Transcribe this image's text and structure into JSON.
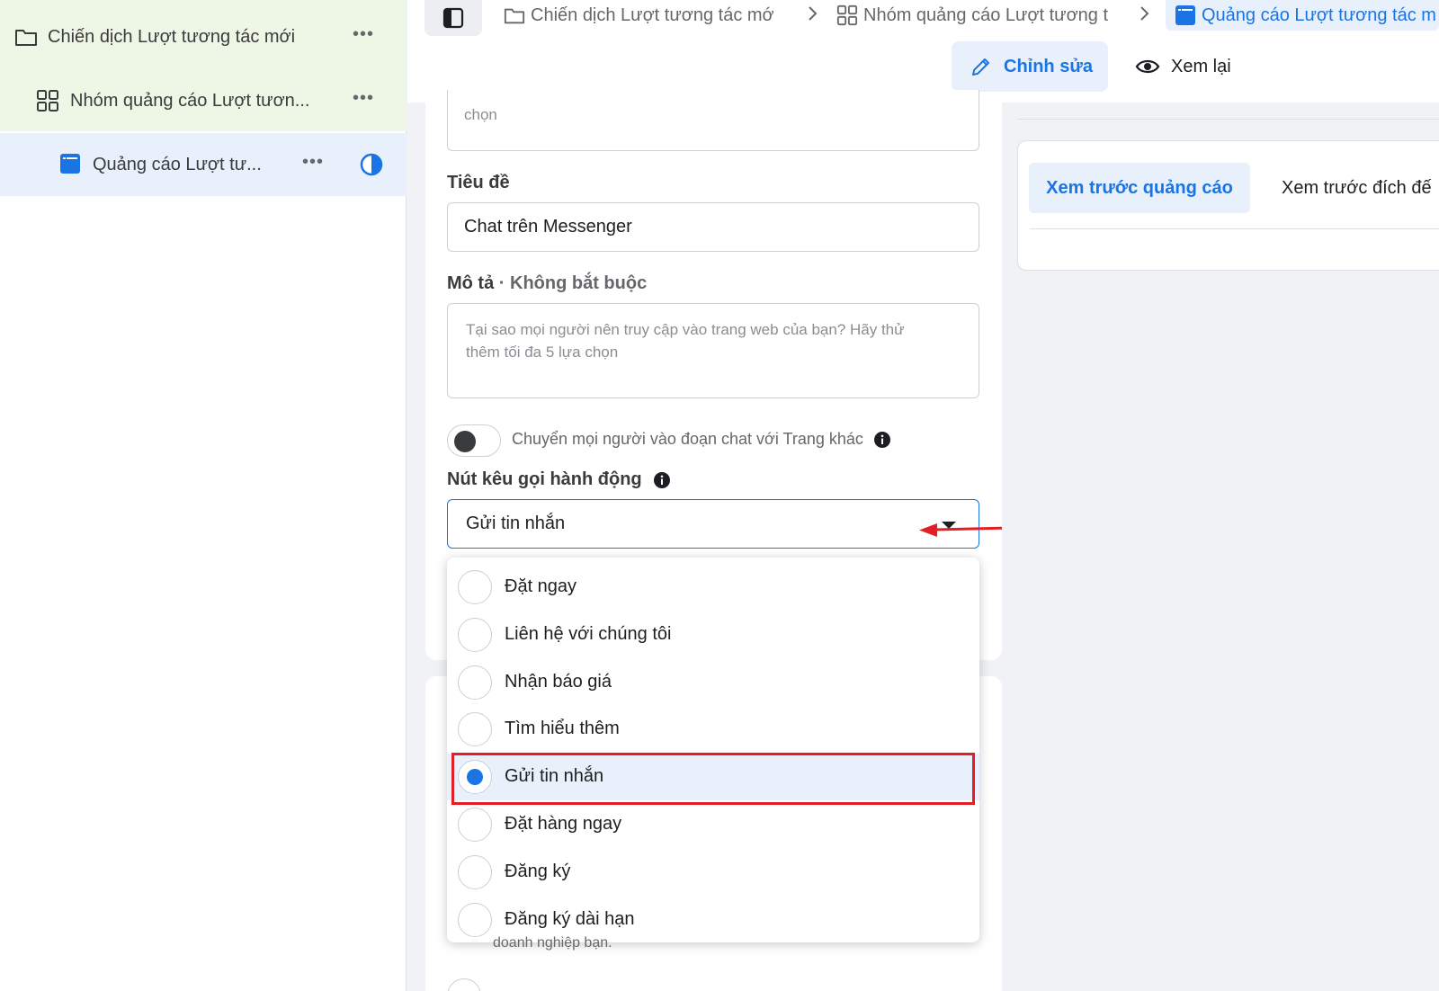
{
  "sidebar": {
    "campaign": {
      "label": "Chiến dịch Lượt tương tác mới",
      "more": "•••"
    },
    "adset": {
      "label": "Nhóm quảng cáo Lượt tươn...",
      "more": "•••"
    },
    "ad": {
      "label": "Quảng cáo Lượt tư...",
      "more": "•••"
    }
  },
  "breadcrumb": {
    "campaign": "Chiến dịch Lượt tương tác mớ",
    "adset": "Nhóm quảng cáo Lượt tương t",
    "ad": "Quảng cáo Lượt tương tác m"
  },
  "modes": {
    "edit": "Chỉnh sửa",
    "review": "Xem lại"
  },
  "form": {
    "prev_field_tail": "chọn",
    "headline": {
      "label": "Tiêu đề",
      "value": "Chat trên Messenger"
    },
    "description": {
      "label": "Mô tả",
      "separator": " · ",
      "optional": "Không bắt buộc",
      "placeholder": "Tại sao mọi người nên truy cập vào trang web của bạn? Hãy thử thêm tối đa 5 lựa chọn"
    },
    "transfer_toggle": {
      "label": "Chuyển mọi người vào đoạn chat với Trang khác",
      "on": false
    },
    "cta": {
      "label": "Nút kêu gọi hành động",
      "selected": "Gửi tin nhắn",
      "options": [
        "Đặt ngay",
        "Liên hệ với chúng tôi",
        "Nhận báo giá",
        "Tìm hiểu thêm",
        "Gửi tin nhắn",
        "Đặt hàng ngay",
        "Đăng ký",
        "Đăng ký dài hạn"
      ],
      "selected_index": 4
    },
    "bottom_text": "doanh nghiệp bạn."
  },
  "preview": {
    "tab_ad": "Xem trước quảng cáo",
    "tab_destination": "Xem trước đích đế"
  },
  "colors": {
    "accent": "#1b74e4",
    "highlight": "#e41e26",
    "selected_bg": "#e7f0fb",
    "sidebar_green": "#eef6e6"
  }
}
